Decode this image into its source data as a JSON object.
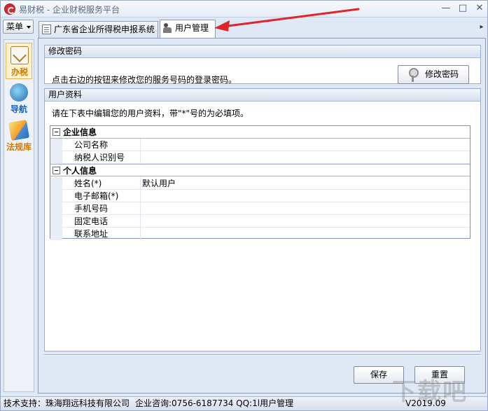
{
  "window": {
    "title": "易财税 - 企业财税服务平台",
    "controls": {
      "minimize": "—",
      "maximize": "□",
      "close": "✕"
    }
  },
  "menu": {
    "label": "菜单"
  },
  "tabs": [
    {
      "label": "广东省企业所得税申报系统",
      "icon": "document-icon",
      "active": false
    },
    {
      "label": "用户管理",
      "icon": "users-icon",
      "active": true
    }
  ],
  "tab_scroll": "▸",
  "sidebar": {
    "items": [
      {
        "label": "办税",
        "icon": "tax-edit-icon",
        "active": true
      },
      {
        "label": "导航",
        "icon": "globe-icon",
        "active": false
      },
      {
        "label": "法规库",
        "icon": "law-book-icon",
        "active": false
      }
    ]
  },
  "password_panel": {
    "title": "修改密码",
    "description": "点击右边的按钮来修改您的服务号码的登录密码。",
    "button_label": "修改密码"
  },
  "user_panel": {
    "title": "用户资料",
    "description": "请在下表中编辑您的用户资料，带\"*\"号的为必填项。",
    "categories": [
      {
        "label": "企业信息",
        "fields": [
          {
            "name": "公司名称",
            "value": ""
          },
          {
            "name": "纳税人识别号",
            "value": ""
          }
        ]
      },
      {
        "label": "个人信息",
        "fields": [
          {
            "name": "姓名(*)",
            "value": "默认用户"
          },
          {
            "name": "电子邮箱(*)",
            "value": ""
          },
          {
            "name": "手机号码",
            "value": ""
          },
          {
            "name": "固定电话",
            "value": ""
          },
          {
            "name": "联系地址",
            "value": ""
          }
        ]
      }
    ]
  },
  "actions": {
    "save": "保存",
    "reset": "重置"
  },
  "statusbar": {
    "support": "技术支持：珠海翔远科技有限公司",
    "consult": "企业咨询:0756-6187734 QQ:1l用户管理",
    "version": "V2019.09"
  },
  "watermark": "下载吧",
  "colors": {
    "accent": "#d8262d",
    "annotation_arrow": "#e0242a",
    "sidebar_label": "#d27a00"
  }
}
